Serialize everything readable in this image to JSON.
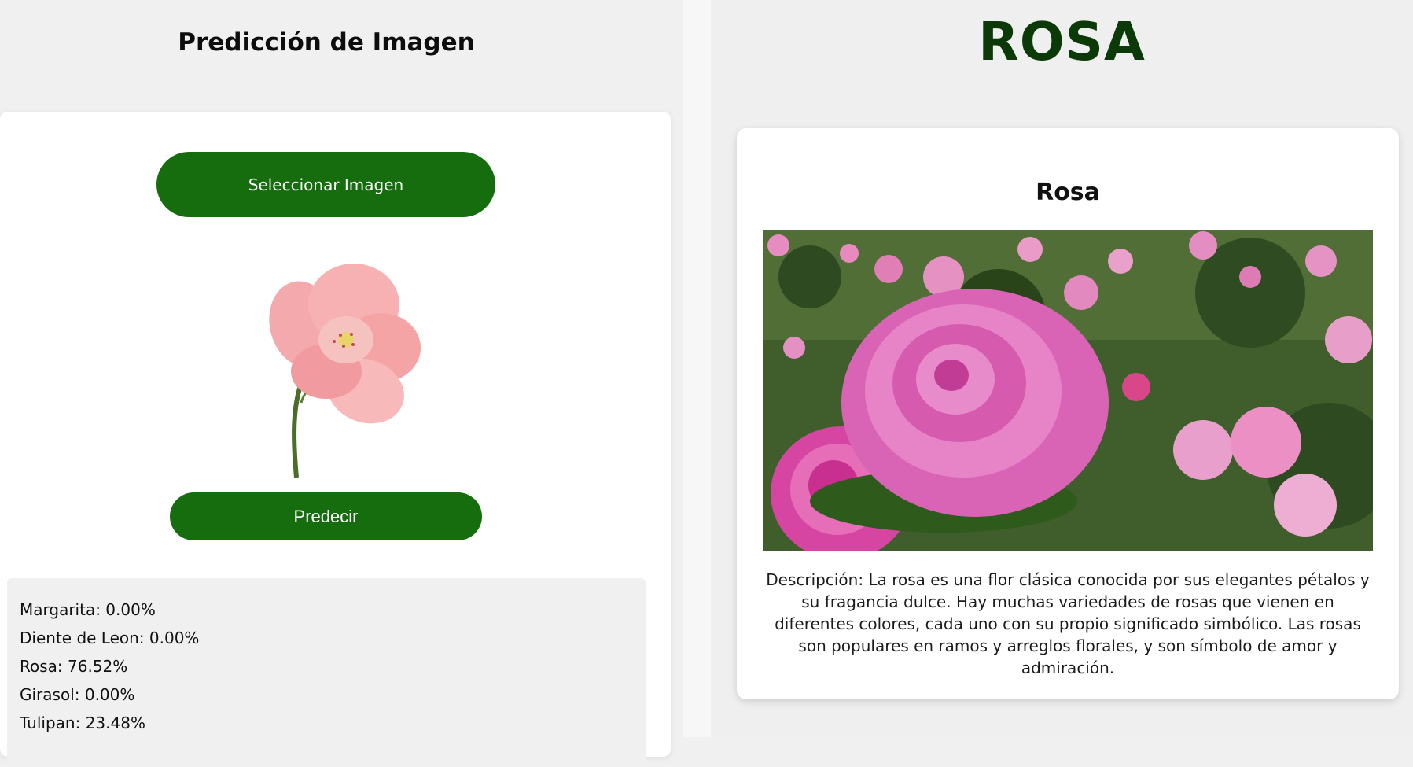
{
  "left": {
    "title": "Predicción de Imagen",
    "select_button_label": "Seleccionar Imagen",
    "predict_button_label": "Predecir",
    "results": [
      "Margarita: 0.00%",
      "Diente de Leon: 0.00%",
      "Rosa: 76.52%",
      "Girasol: 0.00%",
      "Tulipan: 23.48%"
    ]
  },
  "right": {
    "title": "ROSA",
    "flower_name": "Rosa",
    "description": "Descripción: La rosa es una flor clásica conocida por sus elegantes pétalos y su fragancia dulce. Hay muchas variedades de rosas que vienen en diferentes colores, cada uno con su propio significado simbólico. Las rosas son populares en ramos y arreglos florales, y son símbolo de amor y admiración."
  },
  "colors": {
    "button_green": "#156d0d",
    "title_green": "#0b3a08",
    "background": "#f0f0f0"
  }
}
